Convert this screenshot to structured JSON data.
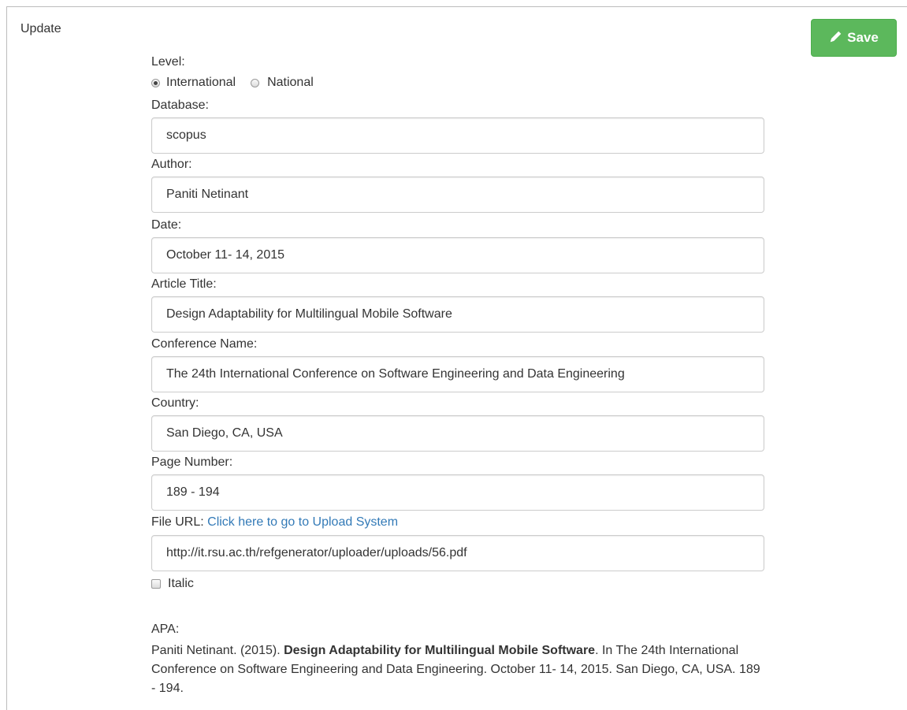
{
  "panel": {
    "title": "Update"
  },
  "save_button": {
    "label": "Save",
    "icon": "pencil-icon",
    "color": "#5cb85c"
  },
  "form": {
    "level": {
      "label": "Level:",
      "options": [
        {
          "label": "International",
          "selected": true
        },
        {
          "label": "National",
          "selected": false
        }
      ]
    },
    "database": {
      "label": "Database:",
      "value": "scopus"
    },
    "author": {
      "label": "Author:",
      "value": "Paniti Netinant"
    },
    "date": {
      "label": "Date:",
      "value": "October 11- 14, 2015"
    },
    "article_title": {
      "label": "Article Title:",
      "value": "Design Adaptability for Multilingual Mobile Software"
    },
    "conference_name": {
      "label": "Conference Name:",
      "value": "The 24th International Conference on Software Engineering and Data Engineering"
    },
    "country": {
      "label": "Country:",
      "value": "San Diego, CA, USA"
    },
    "page_number": {
      "label": "Page Number:",
      "value": "189 - 194"
    },
    "file_url": {
      "label": "File URL:",
      "link_text": "Click here to go to Upload System",
      "value": "http://it.rsu.ac.th/refgenerator/uploader/uploads/56.pdf"
    },
    "italic": {
      "label": "Italic",
      "checked": false
    }
  },
  "apa": {
    "label": "APA:",
    "prefix": "Paniti Netinant. (2015). ",
    "title": "Design Adaptability for Multilingual Mobile Software",
    "suffix": ". In The 24th International Conference on Software Engineering and Data Engineering. October 11- 14, 2015. San Diego, CA, USA. 189 - 194."
  },
  "colors": {
    "link": "#337ab7",
    "text": "#333333",
    "border": "#cccccc"
  }
}
